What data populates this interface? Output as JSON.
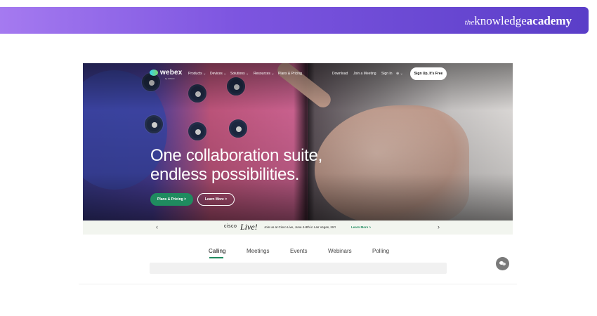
{
  "banner": {
    "brand_the": "the",
    "brand_knowledge": "knowledge",
    "brand_academy": "academy"
  },
  "webex": {
    "logo_text": "webex",
    "logo_sub": "by CISCO",
    "nav": {
      "products": "Products ⌄",
      "devices": "Devices ⌄",
      "solutions": "Solutions ⌄",
      "resources": "Resources ⌄",
      "plans": "Plans & Pricing",
      "download": "Download",
      "join": "Join a Meeting",
      "signin": "Sign In",
      "language": "⊕ ⌄",
      "signup": "Sign Up, It's Free"
    },
    "hero": {
      "title_line1": "One collaboration suite,",
      "title_line2": "endless possibilities.",
      "btn_plans": "Plans & Pricing  >",
      "btn_learn": "Learn More  >"
    },
    "announcement": {
      "prev": "‹",
      "next": "›",
      "logo": "cisco",
      "live": "Live!",
      "text": "Join us at Cisco Live, June 4-8th in Las Vegas, NV!",
      "link": "Learn More  >"
    },
    "tabs": [
      {
        "label": "Calling"
      },
      {
        "label": "Meetings"
      },
      {
        "label": "Events"
      },
      {
        "label": "Webinars"
      },
      {
        "label": "Polling"
      }
    ]
  },
  "colors": {
    "banner_start": "#a57af0",
    "banner_end": "#5a3ec8",
    "webex_green": "#1f8b5f"
  },
  "icons": {
    "chat": "chat-bubble-icon",
    "logo": "webex-logo-icon"
  }
}
